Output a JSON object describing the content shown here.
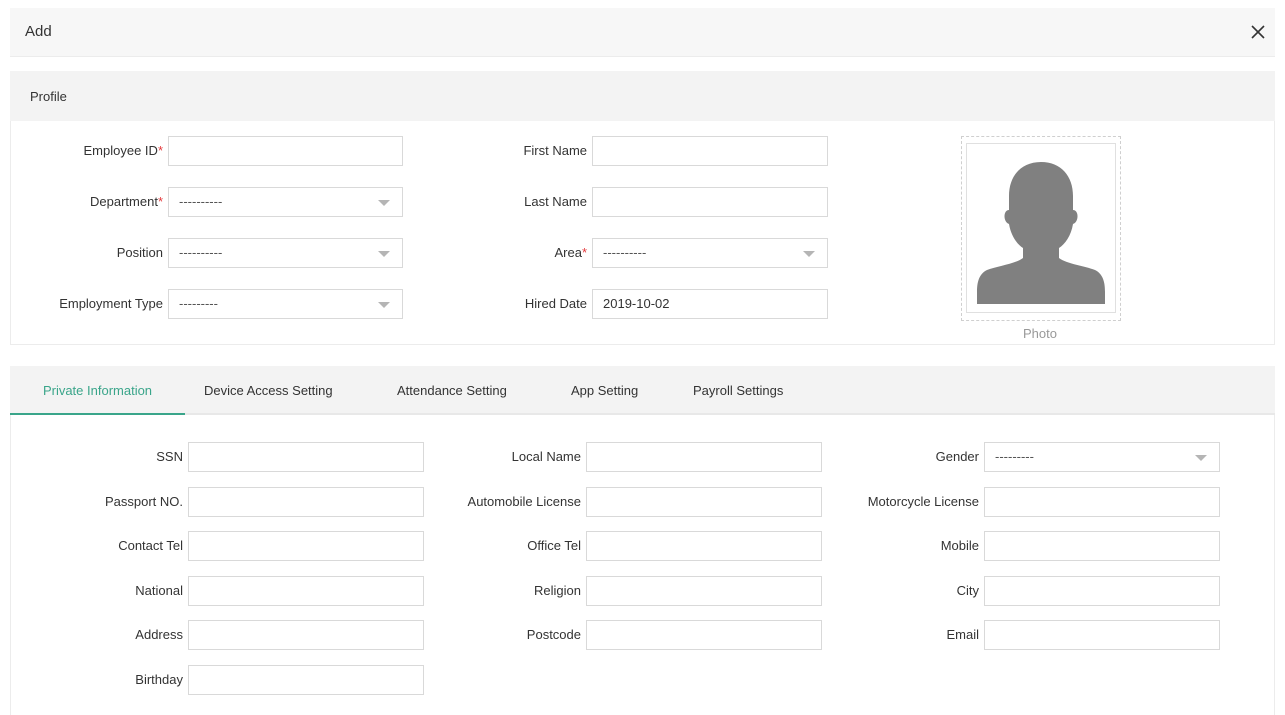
{
  "dialog": {
    "title": "Add"
  },
  "profile": {
    "title": "Profile",
    "employee_id": {
      "label": "Employee ID",
      "value": ""
    },
    "department": {
      "label": "Department",
      "value": "----------"
    },
    "position": {
      "label": "Position",
      "value": "----------"
    },
    "employment_type": {
      "label": "Employment Type",
      "value": "---------"
    },
    "first_name": {
      "label": "First Name",
      "value": ""
    },
    "last_name": {
      "label": "Last Name",
      "value": ""
    },
    "area": {
      "label": "Area",
      "value": "----------"
    },
    "hired_date": {
      "label": "Hired Date",
      "value": "2019-10-02"
    },
    "photo_label": "Photo",
    "required_mark": "*"
  },
  "tabs": [
    {
      "label": "Private Information",
      "active": true
    },
    {
      "label": "Device Access Setting",
      "active": false
    },
    {
      "label": "Attendance Setting",
      "active": false
    },
    {
      "label": "App Setting",
      "active": false
    },
    {
      "label": "Payroll Settings",
      "active": false
    }
  ],
  "private_info": {
    "ssn": {
      "label": "SSN",
      "value": ""
    },
    "passport": {
      "label": "Passport NO.",
      "value": ""
    },
    "contact_tel": {
      "label": "Contact Tel",
      "value": ""
    },
    "national": {
      "label": "National",
      "value": ""
    },
    "address": {
      "label": "Address",
      "value": ""
    },
    "birthday": {
      "label": "Birthday",
      "value": ""
    },
    "local_name": {
      "label": "Local Name",
      "value": ""
    },
    "automobile_license": {
      "label": "Automobile License",
      "value": ""
    },
    "office_tel": {
      "label": "Office Tel",
      "value": ""
    },
    "religion": {
      "label": "Religion",
      "value": ""
    },
    "postcode": {
      "label": "Postcode",
      "value": ""
    },
    "gender": {
      "label": "Gender",
      "value": "---------"
    },
    "motorcycle_license": {
      "label": "Motorcycle License",
      "value": ""
    },
    "mobile": {
      "label": "Mobile",
      "value": ""
    },
    "city": {
      "label": "City",
      "value": ""
    },
    "email": {
      "label": "Email",
      "value": ""
    }
  },
  "colors": {
    "accent": "#3aa58a",
    "required": "#e4393c",
    "avatar": "#808080"
  },
  "icons": {
    "close": "close-icon",
    "dropdown": "chevron-down-icon",
    "photo": "avatar-placeholder-icon"
  }
}
